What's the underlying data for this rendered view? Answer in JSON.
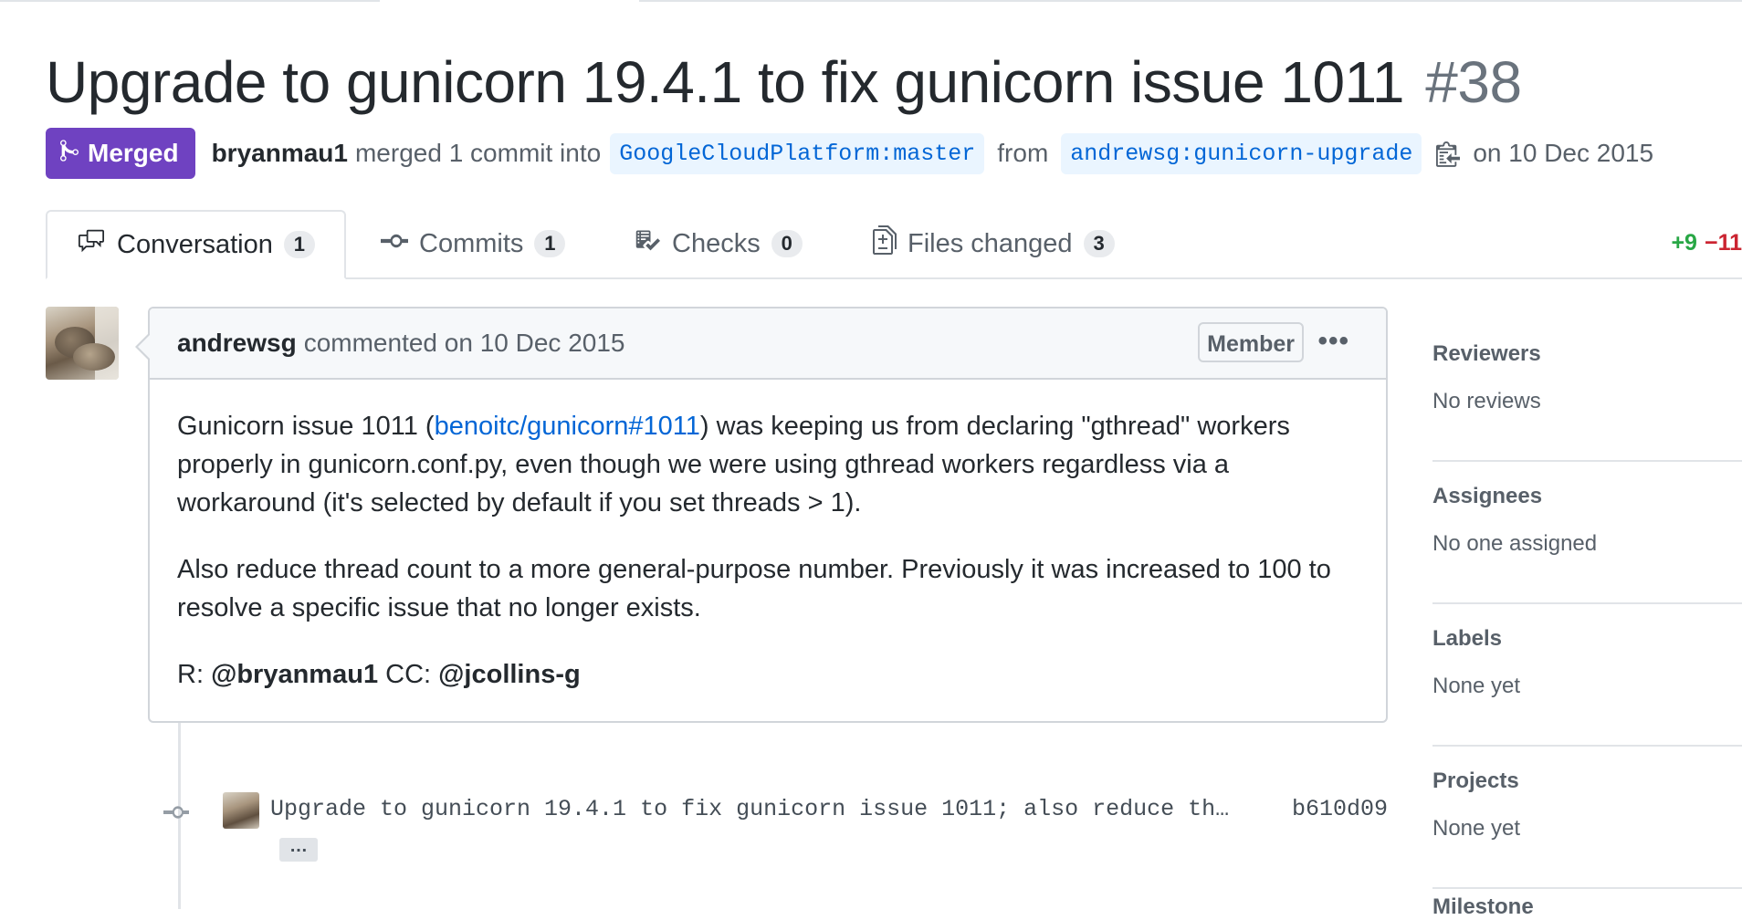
{
  "pr": {
    "title": "Upgrade to gunicorn 19.4.1 to fix gunicorn issue 1011",
    "number": "#38",
    "state_label": "Merged",
    "state_color": "#6f42c1",
    "merged_by": "bryanmau1",
    "merge_text": "merged 1 commit into",
    "base_branch": "GoogleCloudPlatform:master",
    "from_text": "from",
    "head_branch": "andrewsg:gunicorn-upgrade",
    "date_text": "on 10 Dec 2015"
  },
  "tabs": [
    {
      "label": "Conversation",
      "count": "1",
      "icon": "comment-discussion-icon",
      "active": true
    },
    {
      "label": "Commits",
      "count": "1",
      "icon": "git-commit-icon",
      "active": false
    },
    {
      "label": "Checks",
      "count": "0",
      "icon": "checklist-icon",
      "active": false
    },
    {
      "label": "Files changed",
      "count": "3",
      "icon": "file-diff-icon",
      "active": false
    }
  ],
  "diffstat": {
    "additions": "+9",
    "deletions": "−11"
  },
  "comment": {
    "author": "andrewsg",
    "action": "commented on 10 Dec 2015",
    "badge": "Member",
    "menu": "•••",
    "p1_before": "Gunicorn issue 1011 (",
    "p1_link": "benoitc/gunicorn#1011",
    "p1_after": ") was keeping us from declaring \"gthread\" workers properly in gunicorn.conf.py, even though we were using gthread workers regardless via a workaround (it's selected by default if you set threads > 1).",
    "p2": "Also reduce thread count to a more general-purpose number. Previously it was increased to 100 to resolve a specific issue that no longer exists.",
    "p3_r": "R: ",
    "p3_mention1": "@bryanmau1",
    "p3_cc": " CC: ",
    "p3_mention2": "@jcollins-g"
  },
  "commit": {
    "message": "Upgrade to gunicorn 19.4.1 to fix gunicorn issue 1011; also reduce th…",
    "sha": "b610d09",
    "expander": "…"
  },
  "sidebar": {
    "sections": [
      {
        "heading": "Reviewers",
        "value": "No reviews"
      },
      {
        "heading": "Assignees",
        "value": "No one assigned"
      },
      {
        "heading": "Labels",
        "value": "None yet"
      },
      {
        "heading": "Projects",
        "value": "None yet"
      }
    ],
    "partial_heading": "Milestone"
  },
  "colors": {
    "link": "#0366d6",
    "additions": "#28a745",
    "deletions": "#cb2431"
  }
}
